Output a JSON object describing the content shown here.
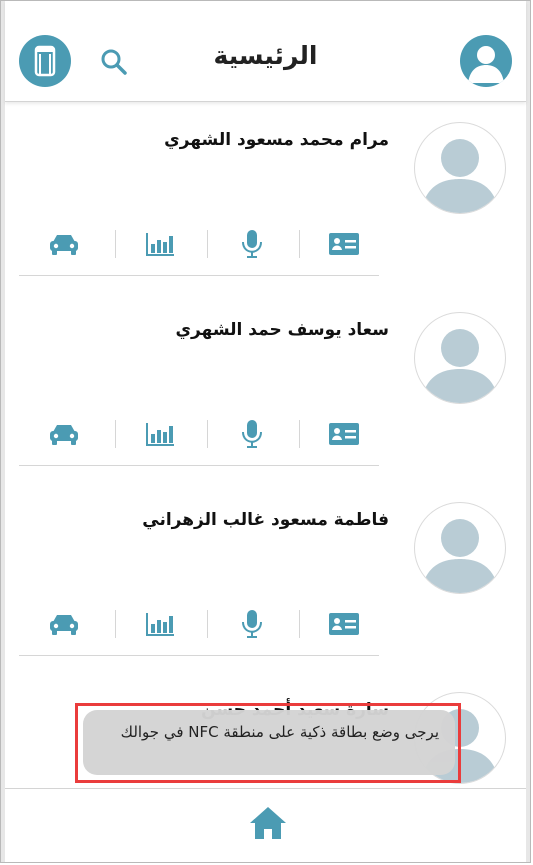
{
  "header": {
    "title": "الرئيسية",
    "nfc_icon": "nfc-phone-icon",
    "search_icon": "search-icon",
    "profile_icon": "user-avatar-icon"
  },
  "colors": {
    "accent": "#4b9bb3",
    "avatar_fill": "#b9ccd5",
    "toast_bg": "#d4d4d4",
    "highlight": "#ea3c3c"
  },
  "cards": [
    {
      "name": "مرام محمد مسعود الشهري"
    },
    {
      "name": "سعاد يوسف حمد الشهري"
    },
    {
      "name": "فاطمة مسعود غالب الزهراني"
    },
    {
      "name": "سارة سعيد أحمد حسن"
    }
  ],
  "card_icons": [
    "id-card-icon",
    "microphone-icon",
    "bar-chart-icon",
    "car-icon"
  ],
  "toast": {
    "message": "يرجى وضع بطاقة ذكية على منطقة NFC في جوالك"
  },
  "bottom_nav": {
    "home_icon": "home-icon"
  }
}
